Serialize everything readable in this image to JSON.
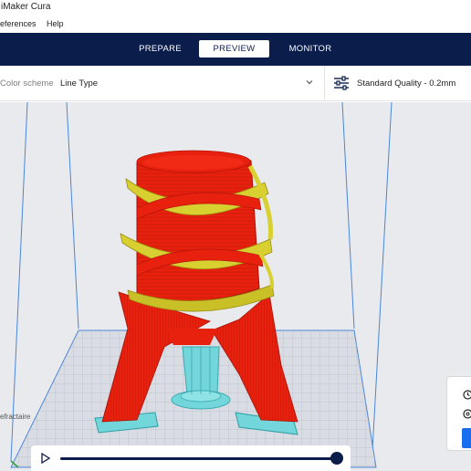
{
  "window": {
    "title": "iMaker Cura"
  },
  "menu": {
    "items": [
      "eferences",
      "Help"
    ]
  },
  "stages": {
    "tabs": [
      {
        "label": "PREPARE",
        "active": false
      },
      {
        "label": "PREVIEW",
        "active": true
      },
      {
        "label": "MONITOR",
        "active": false
      }
    ]
  },
  "preview": {
    "color_scheme_label": "Color scheme",
    "color_scheme_value": "Line Type",
    "quality_label": "Standard Quality - 0.2mm"
  },
  "viewport": {
    "side_label": "efractaire"
  },
  "colors": {
    "header_bg": "#0b1d4a",
    "shell": "#e8210f",
    "infill": "#d8d030",
    "support": "#6fd3d8",
    "action_button": "#196ef0"
  },
  "icons": {
    "settings": "sliders-icon",
    "dropdown": "chevron-down-icon",
    "play": "play-icon",
    "time": "clock-icon",
    "material": "spool-icon"
  }
}
